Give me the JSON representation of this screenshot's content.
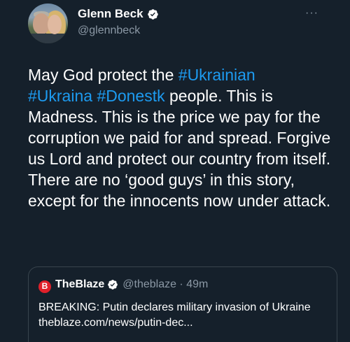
{
  "author": {
    "name": "Glenn Beck",
    "handle": "@glennbeck",
    "more_icon": "···"
  },
  "tweet": {
    "line1_text": "May God protect the ",
    "line1_tag": "#Ukrainian",
    "tag2": "#Ukraina",
    "tag3": "#Donestk",
    "line2_rest": " people.  This is",
    "rest": "Madness.  This is the price we pay for the corruption we paid for and spread. Forgive us Lord and protect our country from itself. There are no ‘good guys’ in this story, except for the innocents now under attack."
  },
  "quoted": {
    "logo_letter": "B",
    "name": "TheBlaze",
    "handle_time": "@theblaze · 49m",
    "text": "BREAKING: Putin declares military invasion of Ukraine theblaze.com/news/putin-dec..."
  },
  "colors": {
    "background": "#15202b",
    "link": "#1d9bf0",
    "secondary_text": "#8b98a5",
    "blaze_red": "#e0202a"
  }
}
